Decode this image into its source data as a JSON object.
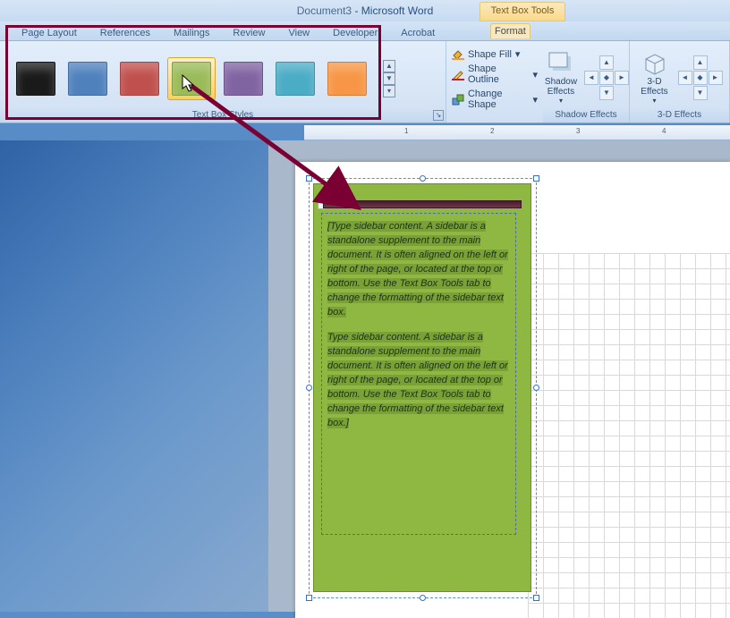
{
  "window": {
    "doc_name": "Document3",
    "app_name": "Microsoft Word",
    "context_tool": "Text Box Tools"
  },
  "tabs": {
    "page_layout": "Page Layout",
    "references": "References",
    "mailings": "Mailings",
    "review": "Review",
    "view": "View",
    "developer": "Developer",
    "acrobat": "Acrobat",
    "format": "Format"
  },
  "ribbon": {
    "styles_label": "Text Box Styles",
    "styles": [
      {
        "name": "black",
        "color": "#1a1a1a"
      },
      {
        "name": "blue",
        "color": "#4f81bd"
      },
      {
        "name": "red",
        "color": "#c0504d"
      },
      {
        "name": "green",
        "color": "#9bbb59"
      },
      {
        "name": "purple",
        "color": "#8064a2"
      },
      {
        "name": "teal",
        "color": "#4bacc6"
      },
      {
        "name": "orange",
        "color": "#f79646"
      }
    ],
    "shape_fill": "Shape Fill",
    "shape_outline": "Shape Outline",
    "change_shape": "Change Shape",
    "shadow_effects_btn": "Shadow Effects",
    "shadow_effects_label": "Shadow Effects",
    "d3_effects_btn": "3-D Effects",
    "d3_effects_label": "3-D Effects"
  },
  "ruler": {
    "marks": [
      "1",
      "2",
      "3",
      "4"
    ]
  },
  "textbox": {
    "para1": "[Type sidebar content. A sidebar is a standalone supplement to the main document. It is often aligned on the left or right of the page, or located at the top or bottom. Use the Text Box Tools tab to change the formatting of the sidebar text box.",
    "para2": "Type sidebar content. A sidebar is a standalone supplement to the main document. It is often aligned on the left or right of the page, or located at the top or bottom. Use the Text Box Tools tab to change the formatting of the sidebar text box.]"
  }
}
